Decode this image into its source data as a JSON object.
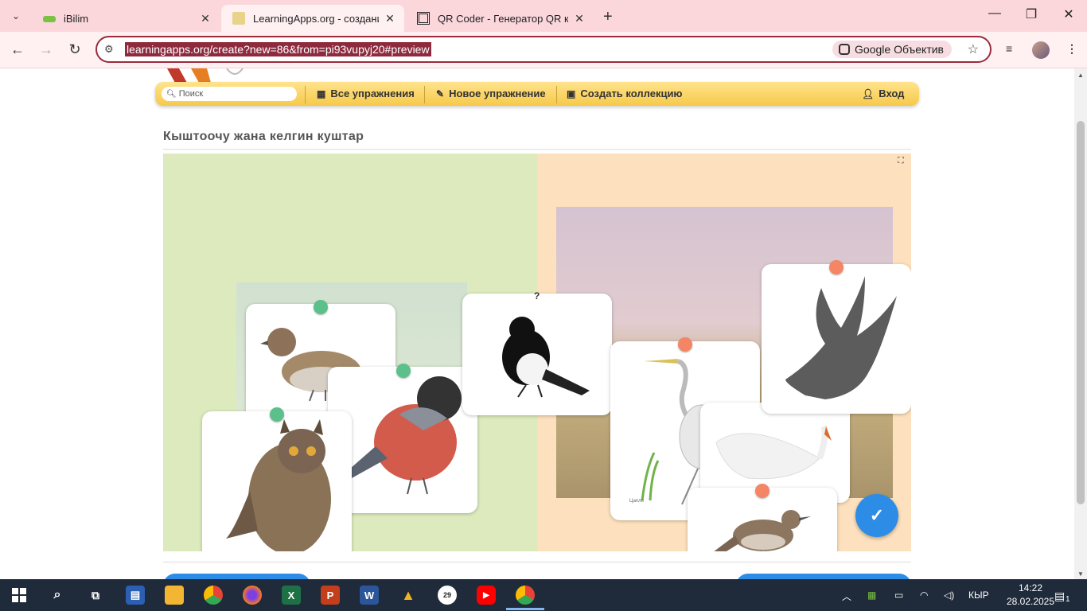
{
  "browser": {
    "tabs": [
      {
        "title": "iBilim",
        "close": "✕",
        "active": false
      },
      {
        "title": "LearningApps.org - создание м",
        "close": "✕",
        "active": true
      },
      {
        "title": "QR Coder - Генератор QR кодо",
        "close": "✕",
        "active": false
      }
    ],
    "new_tab": "+",
    "tab_search": "⌄",
    "window": {
      "minimize": "—",
      "restore": "❐",
      "close": "✕"
    },
    "nav": {
      "back": "←",
      "forward": "→",
      "reload": "↻"
    },
    "url": "learningapps.org/create?new=86&from=pi93vupyj20#preview",
    "lens_label": "Google Объектив",
    "bookmark_icon": "☆",
    "menu_icon": "⋮",
    "media_icon": "≡"
  },
  "site_menu": {
    "search_placeholder": "Поиск",
    "all_exercises": "Все упражнения",
    "new_exercise": "Новое упражнение",
    "create_collection": "Создать коллекцию",
    "login": "Вход"
  },
  "app": {
    "title": "Кыштоочу жана келгин куштар",
    "zones": {
      "left_color": "#dceabd",
      "right_color": "#fde0bd"
    },
    "help_mark": "?",
    "cards": [
      {
        "bird": "sparrow",
        "zone": "left",
        "pin": "green"
      },
      {
        "bird": "bullfinch",
        "zone": "left",
        "pin": "green"
      },
      {
        "bird": "owl",
        "zone": "left",
        "pin": "green"
      },
      {
        "bird": "magpie",
        "zone": "unsorted",
        "pin": "none"
      },
      {
        "bird": "heron",
        "zone": "right",
        "pin": "orange",
        "caption": "Цапля"
      },
      {
        "bird": "swallow",
        "zone": "right",
        "pin": "orange"
      },
      {
        "bird": "swan",
        "zone": "right",
        "pin": "none"
      },
      {
        "bird": "nightingale",
        "zone": "right",
        "pin": "orange"
      }
    ],
    "check_icon": "✓"
  },
  "taskbar": {
    "lang": "КЫР",
    "time": "14:22",
    "date": "28.02.2025",
    "notification_count": "1",
    "badge_29": "29"
  }
}
